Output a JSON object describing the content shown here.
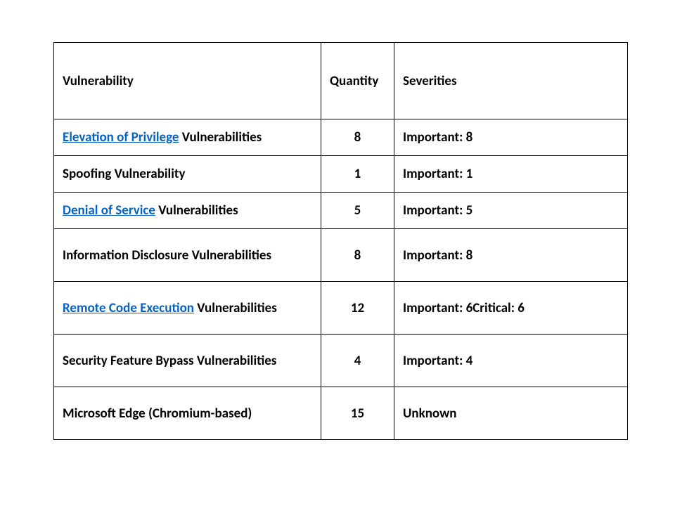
{
  "chart_data": {
    "type": "table",
    "title": "",
    "columns": [
      "Vulnerability",
      "Quantity",
      "Severities"
    ],
    "rows": [
      {
        "vulnerability": "Elevation of Privilege Vulnerabilities",
        "quantity": 8,
        "severities": "Important: 8"
      },
      {
        "vulnerability": "Spoofing Vulnerability",
        "quantity": 1,
        "severities": "Important: 1"
      },
      {
        "vulnerability": "Denial of Service Vulnerabilities",
        "quantity": 5,
        "severities": "Important: 5"
      },
      {
        "vulnerability": "Information Disclosure Vulnerabilities",
        "quantity": 8,
        "severities": "Important: 8"
      },
      {
        "vulnerability": "Remote Code Execution Vulnerabilities",
        "quantity": 12,
        "severities": "Important: 6Critical: 6"
      },
      {
        "vulnerability": "Security Feature Bypass Vulnerabilities",
        "quantity": 4,
        "severities": "Important: 4"
      },
      {
        "vulnerability": "Microsoft Edge (Chromium-based)",
        "quantity": 15,
        "severities": "Unknown"
      }
    ]
  },
  "headers": {
    "vulnerability": "Vulnerability",
    "quantity": "Quantity",
    "severities": "Severities"
  },
  "rows": [
    {
      "link": "Elevation of Privilege",
      "rest": " Vulnerabilities",
      "qty": "8",
      "sev": "Important: 8"
    },
    {
      "link": "",
      "rest": "Spoofing Vulnerability",
      "qty": "1",
      "sev": "Important: 1"
    },
    {
      "link": "Denial of Service",
      "rest": " Vulnerabilities",
      "qty": "5",
      "sev": "Important: 5"
    },
    {
      "link": "",
      "rest": "Information Disclosure Vulnerabilities",
      "qty": "8",
      "sev": "Important: 8"
    },
    {
      "link": "Remote Code Execution",
      "rest": " Vulnerabilities",
      "qty": "12",
      "sev": "Important: 6Critical: 6"
    },
    {
      "link": "",
      "rest": "Security Feature Bypass Vulnerabilities",
      "qty": "4",
      "sev": "Important: 4"
    },
    {
      "link": "",
      "rest": "Microsoft Edge (Chromium-based)",
      "qty": "15",
      "sev": "Unknown"
    }
  ]
}
